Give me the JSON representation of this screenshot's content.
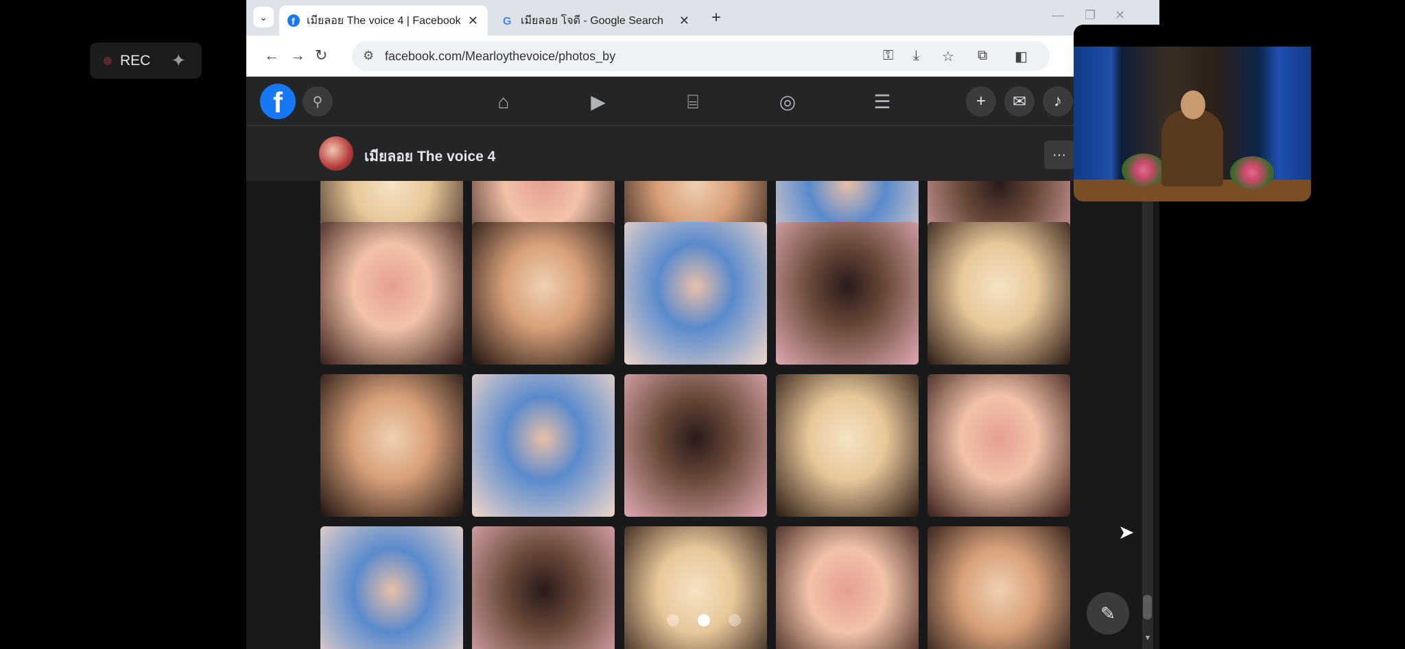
{
  "recorder": {
    "label": "REC",
    "sparkle_icon": "sparkle-icon"
  },
  "browser": {
    "tabs": [
      {
        "title": "เมียลอย The voice 4 | Facebook",
        "favicon": "facebook-icon",
        "active": true
      },
      {
        "title": "เมียลอย โจดี - Google Search",
        "favicon": "google-icon",
        "active": false
      }
    ],
    "url": "facebook.com/Mearloythevoice/photos_by"
  },
  "facebook": {
    "logo": "f",
    "nav_icons": [
      "home-icon",
      "watch-icon",
      "marketplace-icon",
      "groups-icon",
      "menu-icon"
    ],
    "right_icons": [
      "plus-icon",
      "messenger-icon",
      "bell-icon"
    ]
  },
  "page": {
    "name": "เมียลอย The voice 4",
    "more": "···"
  },
  "photos": {
    "rows": [
      [
        "photo",
        "photo",
        "photo",
        "photo",
        "photo"
      ],
      [
        "photo",
        "photo",
        "photo",
        "photo",
        "photo"
      ],
      [
        "photo",
        "photo",
        "photo",
        "photo",
        "photo"
      ],
      [
        "photo",
        "photo",
        "photo",
        "photo",
        "photo"
      ]
    ]
  },
  "colors": {
    "fb_blue": "#1877f2",
    "dark_bg": "#18191a",
    "surface": "#242526"
  }
}
